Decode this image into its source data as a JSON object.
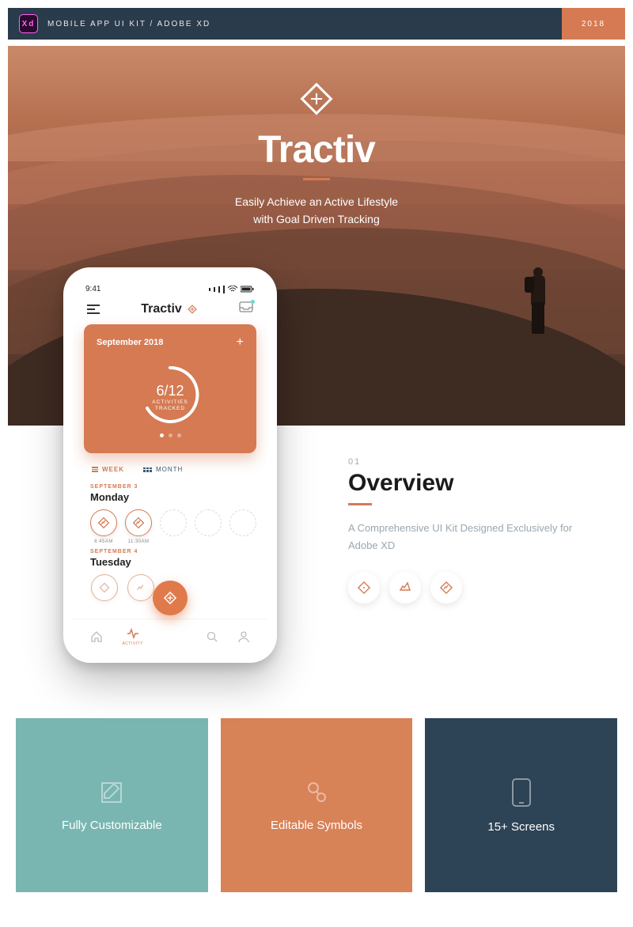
{
  "header": {
    "label": "MOBILE APP UI KIT / ADOBE XD",
    "year": "2018",
    "badge": "Xd"
  },
  "hero": {
    "brand": "Tractiv",
    "tagline1": "Easily Achieve an Active Lifestyle",
    "tagline2": "with Goal Driven Tracking"
  },
  "phone": {
    "time": "9:41",
    "app_title": "Tractiv",
    "card": {
      "month": "September 2018",
      "ring_value": "6/12",
      "ring_label": "ACTIVITIES TRACKED"
    },
    "tabs": {
      "week": "WEEK",
      "month": "MONTH"
    },
    "day1": {
      "date": "SEPTEMBER 3",
      "name": "Monday",
      "t1": "8:45AM",
      "t2": "11:30AM"
    },
    "day2": {
      "date": "SEPTEMBER 4",
      "name": "Tuesday"
    },
    "nav": {
      "activity": "ACTIVITY"
    }
  },
  "overview": {
    "num": "01",
    "title": "Overview",
    "desc": "A Comprehensive UI Kit Designed Exclusively for Adobe XD"
  },
  "features": {
    "f1": "Fully Customizable",
    "f2": "Editable Symbols",
    "f3": "15+ Screens"
  }
}
